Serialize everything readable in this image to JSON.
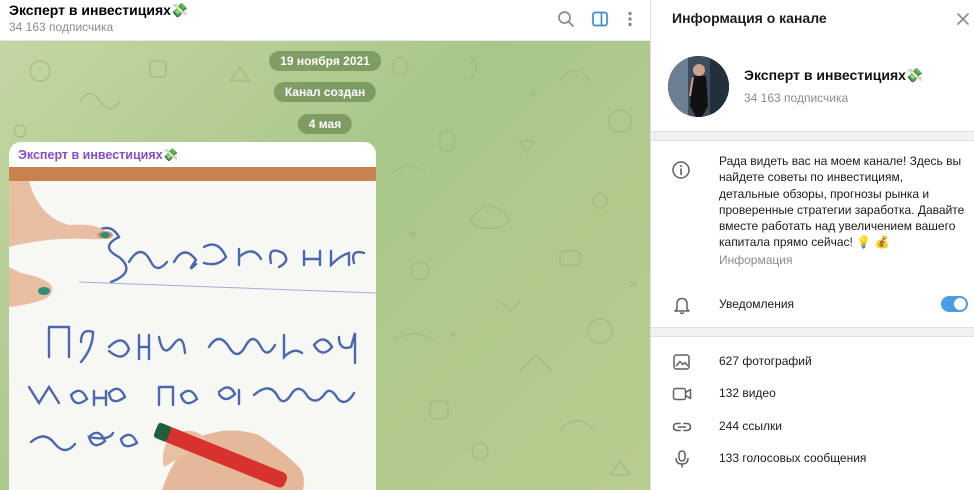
{
  "chat": {
    "title": "Эксперт в инвестициях💸",
    "subscribers": "34 163 подписчика",
    "icons": [
      "search-icon",
      "sidebar-toggle-icon",
      "more-vertical-icon"
    ]
  },
  "service_messages": {
    "date1": "19 ноября 2021",
    "created": "Канал создан",
    "date2": "4 мая"
  },
  "message": {
    "author": "Эксперт в инвестициях💸"
  },
  "info_panel": {
    "title": "Информация о канале",
    "channel_name": "Эксперт в инвестициях💸",
    "subscribers": "34 163 подписчика",
    "about": "Рада видеть вас на моем канале! Здесь вы найдете советы по инвестициям, детальные обзоры, прогнозы рынка и проверенные стратегии заработка. Давайте вместе работать над увеличением вашего капитала прямо сейчас! 💡 💰",
    "about_label": "Информация",
    "notifications_label": "Уведомления",
    "notifications_on": true,
    "media": [
      {
        "label": "627 фотографий",
        "icon": "photo-icon"
      },
      {
        "label": "132 видео",
        "icon": "video-icon"
      },
      {
        "label": "244 ссылки",
        "icon": "link-icon"
      },
      {
        "label": "133 голосовых сообщения",
        "icon": "microphone-icon"
      }
    ]
  },
  "colors": {
    "accent": "#4a9fe4",
    "author": "#8a4bc7",
    "chat_bg": "#b4cc91"
  }
}
